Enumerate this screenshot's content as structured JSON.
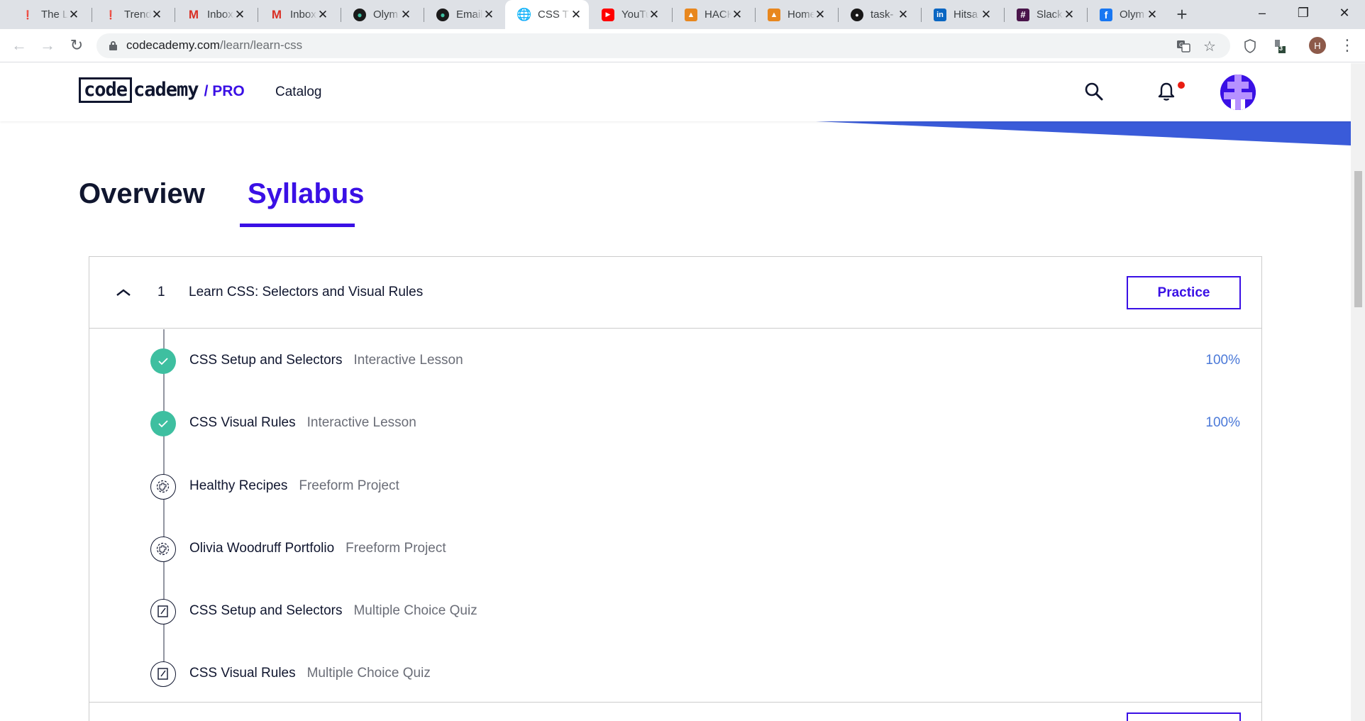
{
  "browser": {
    "tabs": [
      {
        "title": "The L",
        "favicon": "pinterest-like-red-icon",
        "active": false
      },
      {
        "title": "Trend",
        "favicon": "pinterest-like-red-icon",
        "active": false
      },
      {
        "title": "Inbox",
        "favicon": "gmail-icon",
        "active": false
      },
      {
        "title": "Inbox",
        "favicon": "gmail-icon",
        "active": false
      },
      {
        "title": "Olym",
        "favicon": "olympus-icon",
        "active": false
      },
      {
        "title": "Email",
        "favicon": "olympus-icon",
        "active": false
      },
      {
        "title": "CSS T",
        "favicon": "globe-icon",
        "active": true
      },
      {
        "title": "YouTu",
        "favicon": "youtube-icon",
        "active": false
      },
      {
        "title": "HACK",
        "favicon": "fox-icon",
        "active": false
      },
      {
        "title": "Home",
        "favicon": "fox-icon",
        "active": false
      },
      {
        "title": "task-",
        "favicon": "github-icon",
        "active": false
      },
      {
        "title": "Hitsa",
        "favicon": "linkedin-icon",
        "active": false
      },
      {
        "title": "Slack",
        "favicon": "slack-icon",
        "active": false
      },
      {
        "title": "Olym",
        "favicon": "facebook-icon",
        "active": false
      }
    ],
    "url_host": "codecademy.com",
    "url_path": "/learn/learn-css",
    "profile_initial": "H",
    "extension_badge": "3"
  },
  "site": {
    "logo_code": "code",
    "logo_rest": "cademy",
    "logo_pro": "/ PRO",
    "catalog": "Catalog"
  },
  "page_tabs": {
    "overview": "Overview",
    "syllabus": "Syllabus"
  },
  "module": {
    "number": "1",
    "title": "Learn CSS: Selectors and Visual Rules",
    "practice_label": "Practice",
    "items": [
      {
        "title": "CSS Setup and Selectors",
        "type": "Interactive Lesson",
        "status": "done",
        "progress": "100%"
      },
      {
        "title": "CSS Visual Rules",
        "type": "Interactive Lesson",
        "status": "done",
        "progress": "100%"
      },
      {
        "title": "Healthy Recipes",
        "type": "Freeform Project",
        "status": "project",
        "progress": ""
      },
      {
        "title": "Olivia Woodruff Portfolio",
        "type": "Freeform Project",
        "status": "project",
        "progress": ""
      },
      {
        "title": "CSS Setup and Selectors",
        "type": "Multiple Choice Quiz",
        "status": "quiz",
        "progress": ""
      },
      {
        "title": "CSS Visual Rules",
        "type": "Multiple Choice Quiz",
        "status": "quiz",
        "progress": ""
      }
    ]
  },
  "colors": {
    "brand_purple": "#3a10e5",
    "done_green": "#3ebfa0",
    "progress_blue": "#4b79d8",
    "stripe_blue": "#3a5bd9"
  }
}
